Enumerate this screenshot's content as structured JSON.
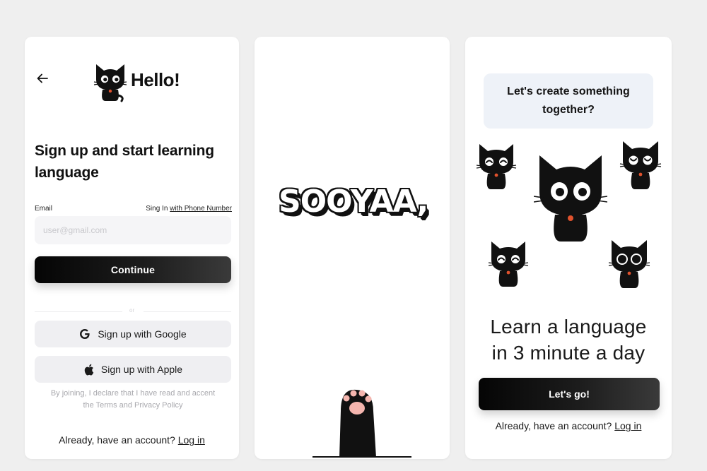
{
  "signup_screen": {
    "greeting": "Hello!",
    "title": "Sign up and start learning language",
    "email_label": "Email",
    "phone_prefix": "Sing In",
    "phone_link": "with Phone Number",
    "email_placeholder": "user@gmail.com",
    "continue_label": "Continue",
    "or_text": "or",
    "google_label": "Sign up with Google",
    "apple_label": "Sign up with Apple",
    "legal_text": "By joining, I declare that I have read and accent",
    "legal_link": "the Terms and Privacy Policy",
    "account_prompt": "Already, have an account?",
    "login_label": "Log in"
  },
  "splash_screen": {
    "brand": "SOOYAA,"
  },
  "onboarding_screen": {
    "bubble_text": "Let's create something together?",
    "tagline_line1": "Learn a language",
    "tagline_line2": "in 3 minute a day",
    "cta_label": "Let's go!",
    "account_prompt": "Already, have an account?",
    "login_label": "Log in"
  },
  "colors": {
    "background": "#efefef",
    "card": "#ffffff",
    "primary_button": "#111111",
    "input_bg": "#f5f5f7",
    "secondary_button": "#efeff2",
    "bubble_bg": "#eef2f8",
    "paw_pad": "#f4b5ae",
    "collar": "#e0522d"
  },
  "icons": [
    "back-arrow-icon",
    "google-icon",
    "apple-icon",
    "cat-mascot-icon",
    "cat-paw-icon"
  ]
}
